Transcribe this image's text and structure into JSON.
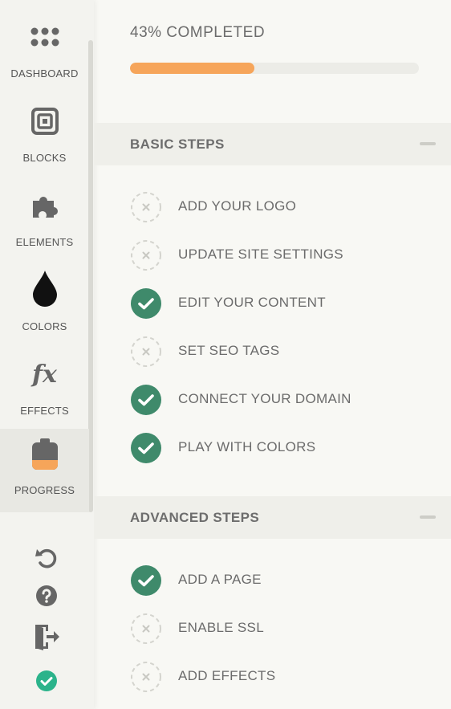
{
  "colors": {
    "accent": "#f6a55a",
    "done_green": "#3f8a6b",
    "pending_gray": "#d4d4ce",
    "status_teal": "#2bb38b"
  },
  "sidebar": {
    "items": [
      {
        "label": "DASHBOARD",
        "icon": "dots-grid-icon",
        "active": false
      },
      {
        "label": "BLOCKS",
        "icon": "block-square-icon",
        "active": false
      },
      {
        "label": "ELEMENTS",
        "icon": "puzzle-icon",
        "active": false
      },
      {
        "label": "COLORS",
        "icon": "drop-icon",
        "active": false
      },
      {
        "label": "EFFECTS",
        "icon": "fx-icon",
        "active": false
      },
      {
        "label": "PROGRESS",
        "icon": "clipboard-progress-icon",
        "active": true
      }
    ],
    "effects_glyph": "fx",
    "utility_icons": [
      "undo-icon",
      "help-icon",
      "exit-door-icon",
      "status-check-icon"
    ]
  },
  "progress": {
    "text": "43%  COMPLETED",
    "value": 0.43
  },
  "sections": [
    {
      "title": "BASIC STEPS",
      "steps": [
        {
          "label": "ADD YOUR LOGO",
          "done": false
        },
        {
          "label": "UPDATE SITE SETTINGS",
          "done": false
        },
        {
          "label": "EDIT YOUR CONTENT",
          "done": true
        },
        {
          "label": "SET SEO TAGS",
          "done": false
        },
        {
          "label": "CONNECT YOUR DOMAIN",
          "done": true
        },
        {
          "label": "PLAY WITH COLORS",
          "done": true
        }
      ]
    },
    {
      "title": "ADVANCED STEPS",
      "steps": [
        {
          "label": "ADD A PAGE",
          "done": true
        },
        {
          "label": "ENABLE SSL",
          "done": false
        },
        {
          "label": "ADD EFFECTS",
          "done": false
        }
      ]
    }
  ]
}
